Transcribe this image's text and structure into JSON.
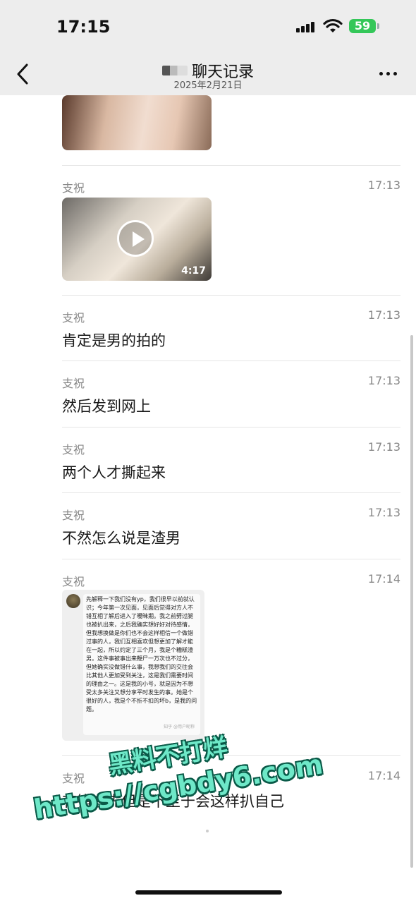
{
  "status_bar": {
    "time": "17:15",
    "battery": "59"
  },
  "nav": {
    "title": "聊天记录",
    "subtitle": "2025年2月21日",
    "back_icon": "chevron-left-icon",
    "more_icon": "more-dots-icon"
  },
  "messages": [
    {
      "type": "image"
    },
    {
      "sender": "支祝",
      "time": "17:13",
      "type": "video",
      "duration": "4:17"
    },
    {
      "sender": "支祝",
      "time": "17:13",
      "type": "text",
      "text": "肯定是男的拍的"
    },
    {
      "sender": "支祝",
      "time": "17:13",
      "type": "text",
      "text": "然后发到网上"
    },
    {
      "sender": "支祝",
      "time": "17:13",
      "type": "text",
      "text": "两个人才撕起来"
    },
    {
      "sender": "支祝",
      "time": "17:13",
      "type": "text",
      "text": "不然怎么说是渣男"
    },
    {
      "sender": "支祝",
      "time": "17:14",
      "type": "screenshot",
      "card_text": "先解释一下我们没有yp，我们很早以前就认识；今年第一次见面，见面后觉得对方人不错互相了解后进入了暧昧期。我之前劈过腿也被扒出来，之后我确实想好好对待感情，但我想换做是你们也不会这样相信一个做错过事的人，我们互相喜欢但想更加了解才能在一起，所以约定了三个月，我是个糟糕渣男。这件事被事出来鞭尸一万次也不过分，但她确实没做错什么事，我想我们的交往会比其他人更加受到关注，这是我们需要时间的理由之一。这是我的小号，就是因为不想受太多关注又想分享平时发生的事。她是个很好的人，我是个不折不扣的坏b，是我的问题。",
      "card_footer": "知乎 @用户昵称"
    },
    {
      "sender": "支祝",
      "time": "17:14",
      "type": "text",
      "text": "有错在先但是不至于会这样扒自己"
    }
  ],
  "watermark": {
    "line1": "黑料不打烊",
    "line2": "https://cgbdy6.com"
  },
  "colors": {
    "nav_background": "#ededed",
    "watermark_fill": "#6ee8c8",
    "watermark_outline": "#0a5a48",
    "battery_green": "#34c759",
    "meta_gray": "#888888"
  }
}
